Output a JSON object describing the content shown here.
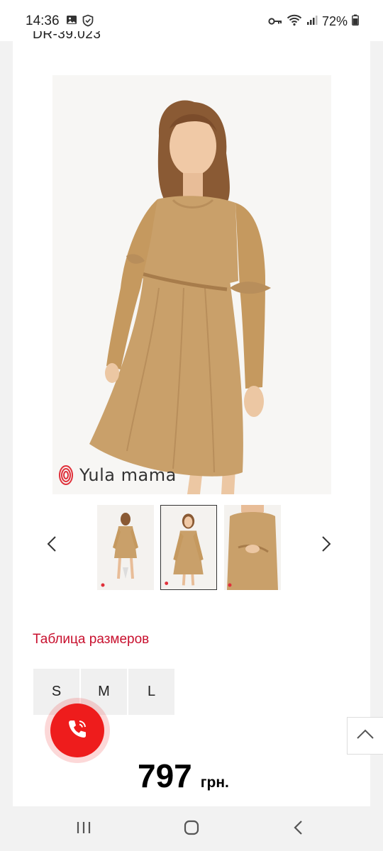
{
  "status_bar": {
    "time": "14:36",
    "battery": "72%"
  },
  "product": {
    "sku": "DR-39.023",
    "brand": "Yula mama",
    "size_table_label": "Таблица размеров",
    "sizes": [
      "S",
      "M",
      "L"
    ],
    "price_value": "797",
    "price_currency": "грн."
  },
  "colors": {
    "accent": "#c8102e",
    "call": "#ee1c1c",
    "dress": "#c9a06a"
  },
  "icons": {
    "status": [
      "image-icon",
      "shield-icon",
      "key-icon",
      "wifi-icon",
      "signal-icon",
      "battery-icon"
    ],
    "carousel": [
      "chevron-left-icon",
      "chevron-right-icon"
    ],
    "call": "phone-icon",
    "scroll": "chevron-up-icon",
    "nav": [
      "recents-icon",
      "home-icon",
      "back-icon"
    ]
  }
}
